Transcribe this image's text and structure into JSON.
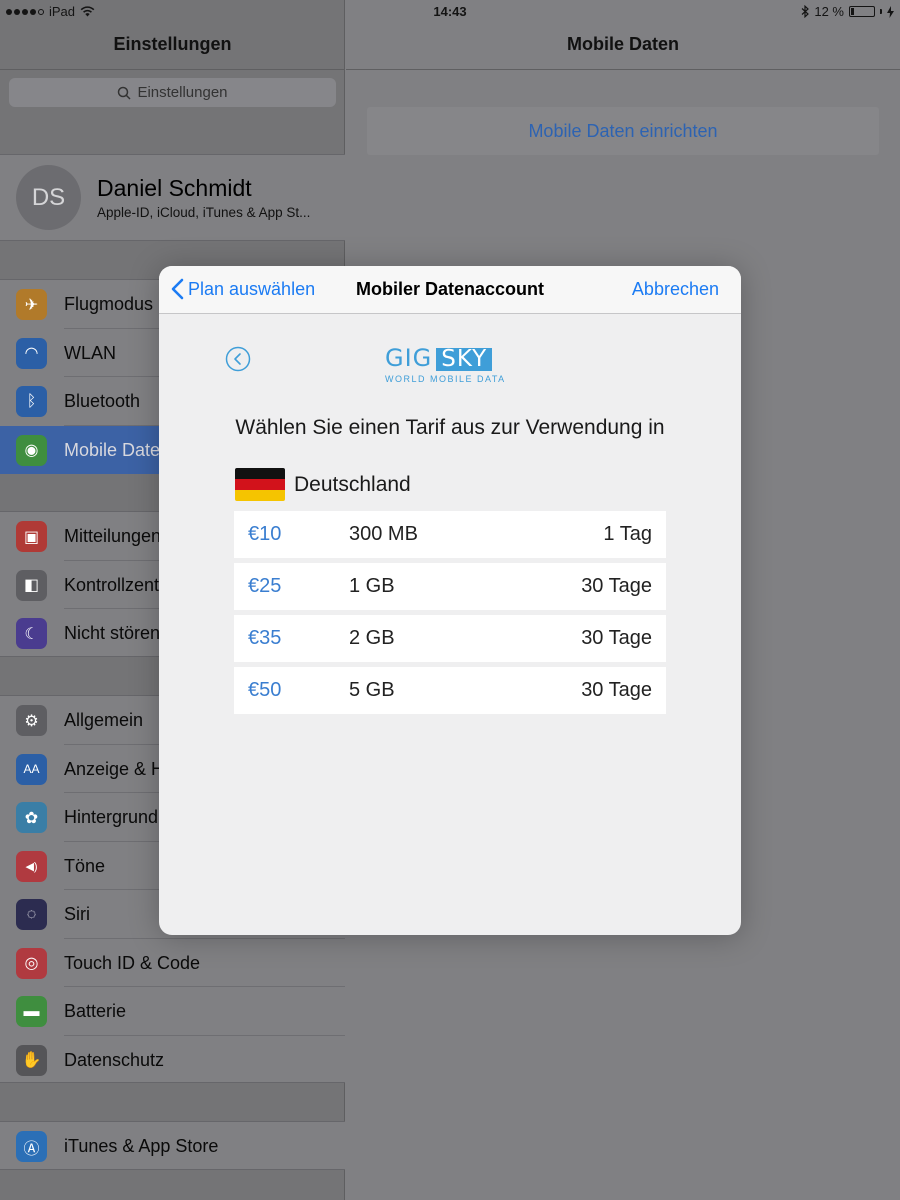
{
  "status_bar": {
    "carrier": "iPad",
    "time": "14:43",
    "battery": "12 %",
    "battery_level": 0.12
  },
  "sidebar": {
    "title": "Einstellungen",
    "search_placeholder": "Einstellungen",
    "profile": {
      "initials": "DS",
      "name": "Daniel Schmidt",
      "subtitle": "Apple-ID, iCloud, iTunes & App St..."
    },
    "groups": [
      [
        {
          "label": "Flugmodus",
          "icon": "airplane-icon",
          "color": "#b17a2a"
        },
        {
          "label": "WLAN",
          "icon": "wifi-icon",
          "color": "#2b5fa6"
        },
        {
          "label": "Bluetooth",
          "icon": "bluetooth-icon",
          "color": "#2b5fa6"
        },
        {
          "label": "Mobile Daten",
          "icon": "antenna-icon",
          "color": "#3f8e3f",
          "selected": true
        }
      ],
      [
        {
          "label": "Mitteilungen",
          "icon": "notifications-icon",
          "color": "#b03a36"
        },
        {
          "label": "Kontrollzentrum",
          "icon": "switches-icon",
          "color": "#5e5e62"
        },
        {
          "label": "Nicht stören",
          "icon": "moon-icon",
          "color": "#4a3c8f"
        }
      ],
      [
        {
          "label": "Allgemein",
          "icon": "gear-icon",
          "color": "#5e5e62"
        },
        {
          "label": "Anzeige & Helligkeit",
          "icon": "text-size-icon",
          "color": "#2b5fa6"
        },
        {
          "label": "Hintergrundbild",
          "icon": "flower-icon",
          "color": "#3a7ea6"
        },
        {
          "label": "Töne",
          "icon": "speaker-icon",
          "color": "#b03a40"
        },
        {
          "label": "Siri",
          "icon": "siri-icon",
          "color": "#2c2c50"
        },
        {
          "label": "Touch ID & Code",
          "icon": "fingerprint-icon",
          "color": "#b03a40"
        },
        {
          "label": "Batterie",
          "icon": "battery-icon",
          "color": "#3f8e3f"
        },
        {
          "label": "Datenschutz",
          "icon": "hand-icon",
          "color": "#555558"
        }
      ],
      [
        {
          "label": "iTunes & App Store",
          "icon": "app-store-icon",
          "color": "#2b6fb6"
        }
      ]
    ]
  },
  "detail": {
    "title": "Mobile Daten",
    "setup_button": "Mobile Daten einrichten"
  },
  "modal": {
    "back_label": "Plan auswählen",
    "title": "Mobiler Datenaccount",
    "cancel_label": "Abbrechen",
    "logo": {
      "word1": "GIG",
      "word2": "SKY",
      "tagline": "WORLD MOBILE DATA"
    },
    "heading": "Wählen Sie einen Tarif aus zur Verwendung in",
    "country": "Deutschland",
    "plans": [
      {
        "price": "€10",
        "data": "300 MB",
        "duration": "1 Tag"
      },
      {
        "price": "€25",
        "data": "1 GB",
        "duration": "30 Tage"
      },
      {
        "price": "€35",
        "data": "2 GB",
        "duration": "30 Tage"
      },
      {
        "price": "€50",
        "data": "5 GB",
        "duration": "30 Tage"
      }
    ],
    "accent_color": "#1b7bf3",
    "brand_color": "#3f9ed8"
  }
}
